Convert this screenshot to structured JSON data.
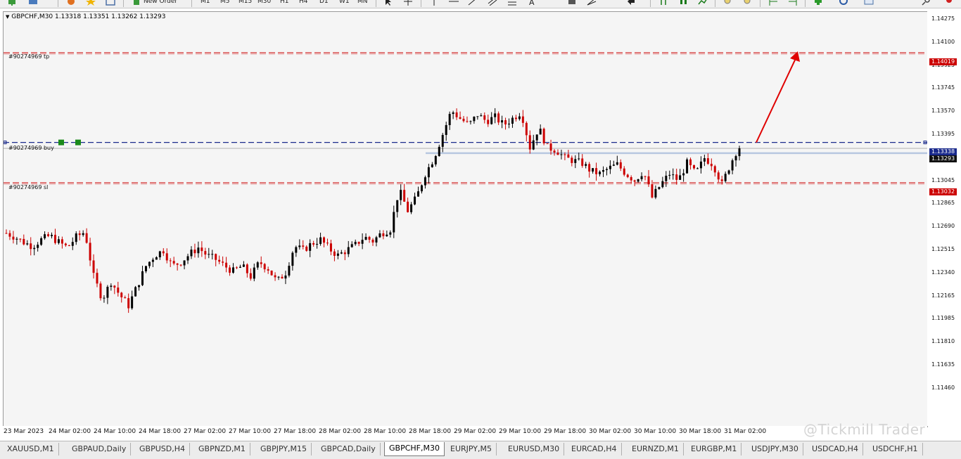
{
  "toolbar": {
    "new_order_label": "New Order",
    "timeframes": [
      "M1",
      "M5",
      "M15",
      "M30",
      "H1",
      "H4",
      "D1",
      "W1",
      "MN"
    ]
  },
  "chart": {
    "symbol_info": "GBPCHF,M30  1.13318 1.13351 1.13262 1.13293",
    "order_tp_label": "#90274969 tp",
    "order_buy_label": "#90274969 buy",
    "order_sl_label": "#90274969 sl",
    "tp_price": "1.14019",
    "bid_price": "1.13338",
    "ask_price": "1.13293",
    "sl_price": "1.13032",
    "colors": {
      "background": "#f5f5f5",
      "bull_candle": "#000000",
      "bear_candle": "#cc0000",
      "tp_line": "#cc0000",
      "sl_line": "#cc0000",
      "buy_line": "#1a2a8c",
      "ask_line": "#b8c8e0",
      "arrow": "#e00000"
    }
  },
  "price_axis": {
    "labels": [
      "1.14275",
      "1.14100",
      "1.13925",
      "1.13745",
      "1.13570",
      "1.13395",
      "1.13220",
      "1.13045",
      "1.12865",
      "1.12690",
      "1.12515",
      "1.12340",
      "1.12165",
      "1.11985",
      "1.11810",
      "1.11635",
      "1.11460"
    ]
  },
  "time_axis": {
    "labels": [
      "23 Mar 2023",
      "24 Mar 02:00",
      "24 Mar 10:00",
      "24 Mar 18:00",
      "27 Mar 02:00",
      "27 Mar 10:00",
      "27 Mar 18:00",
      "28 Mar 02:00",
      "28 Mar 10:00",
      "28 Mar 18:00",
      "29 Mar 02:00",
      "29 Mar 10:00",
      "29 Mar 18:00",
      "30 Mar 02:00",
      "30 Mar 10:00",
      "30 Mar 18:00",
      "31 Mar 02:00"
    ]
  },
  "tabs": [
    "XAUUSD,M1",
    "GBPAUD,Daily",
    "GBPUSD,H4",
    "GBPNZD,M1",
    "GBPJPY,M15",
    "GBPCAD,Daily",
    "GBPCHF,M30",
    "EURJPY,M5",
    "EURUSD,M30",
    "EURCAD,H4",
    "EURNZD,M1",
    "EURGBP,M1",
    "USDJPY,M30",
    "USDCAD,H4",
    "USDCHF,H1"
  ],
  "active_tab": "GBPCHF,M30",
  "watermark": "@Tickmill Trader",
  "chart_data": {
    "type": "candlestick",
    "symbol": "GBPCHF",
    "timeframe": "M30",
    "last_bar": {
      "open": 1.13318,
      "high": 1.13351,
      "low": 1.13262,
      "close": 1.13293
    },
    "levels": {
      "take_profit": 1.14019,
      "entry_buy": 1.13338,
      "stop_loss": 1.13032,
      "current": 1.13293
    },
    "approx_close_path": [
      1.1265,
      1.1262,
      1.1258,
      1.1255,
      1.126,
      1.1263,
      1.1258,
      1.1254,
      1.1262,
      1.1266,
      1.1232,
      1.1215,
      1.1228,
      1.1218,
      1.121,
      1.1225,
      1.124,
      1.1248,
      1.1252,
      1.124,
      1.1243,
      1.1249,
      1.1254,
      1.1248,
      1.1245,
      1.124,
      1.1236,
      1.124,
      1.1232,
      1.1243,
      1.1238,
      1.1228,
      1.1235,
      1.1255,
      1.1252,
      1.1257,
      1.126,
      1.1253,
      1.1248,
      1.1252,
      1.1256,
      1.1262,
      1.1259,
      1.1265,
      1.1268,
      1.1298,
      1.1282,
      1.1292,
      1.131,
      1.1322,
      1.134,
      1.1358,
      1.1352,
      1.1347,
      1.1355,
      1.135,
      1.1353,
      1.1347,
      1.1352,
      1.1357,
      1.133,
      1.1345,
      1.133,
      1.1328,
      1.1322,
      1.132,
      1.1318,
      1.1312,
      1.131,
      1.1314,
      1.1317,
      1.131,
      1.1305,
      1.1312,
      1.1292,
      1.1302,
      1.131,
      1.1305,
      1.1318,
      1.131,
      1.1322,
      1.1317,
      1.1302,
      1.1318,
      1.1332
    ]
  }
}
